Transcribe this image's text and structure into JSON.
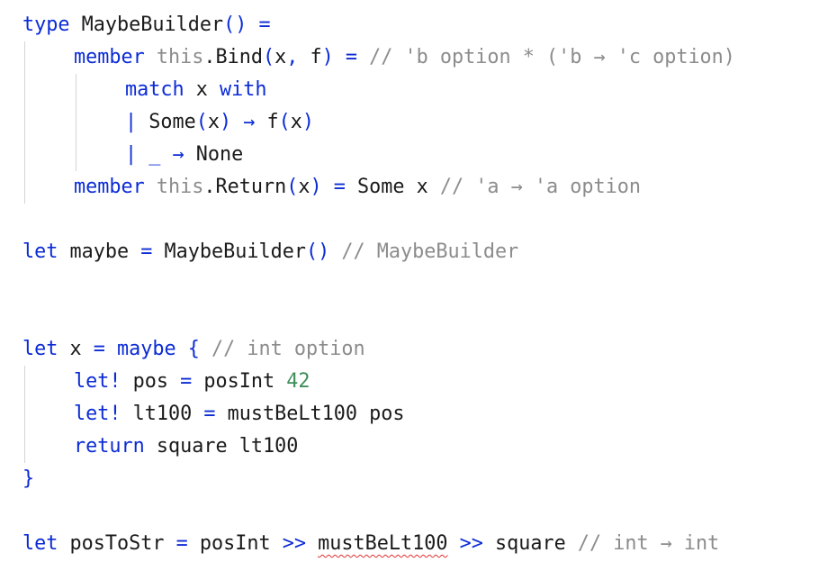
{
  "editor": {
    "colors": {
      "background": "#ffffff",
      "keyword": "#0b2bd6",
      "comment": "#8c8c8c",
      "number": "#3f8f5a",
      "text": "#1a1a1a",
      "error_underline": "#e03131"
    },
    "lines": [
      {
        "id": "L1",
        "tokens": [
          {
            "t": "type",
            "c": "kw"
          },
          {
            "t": " MaybeBuilder",
            "c": ""
          },
          {
            "t": "()",
            "c": "pn"
          },
          {
            "t": " ",
            "c": ""
          },
          {
            "t": "=",
            "c": "pn"
          }
        ]
      },
      {
        "id": "L2",
        "tokens": [
          {
            "t": "member",
            "c": "kw"
          },
          {
            "t": " ",
            "c": ""
          },
          {
            "t": "this",
            "c": "sl"
          },
          {
            "t": ".Bind",
            "c": ""
          },
          {
            "t": "(",
            "c": "pn"
          },
          {
            "t": "x",
            "c": ""
          },
          {
            "t": ",",
            "c": "pn"
          },
          {
            "t": " f",
            "c": ""
          },
          {
            "t": ")",
            "c": "pn"
          },
          {
            "t": " ",
            "c": ""
          },
          {
            "t": "=",
            "c": "pn"
          },
          {
            "t": " // 'b option * ('b → 'c option)",
            "c": "cm"
          }
        ]
      },
      {
        "id": "L3",
        "tokens": [
          {
            "t": "match",
            "c": "kw"
          },
          {
            "t": " x ",
            "c": ""
          },
          {
            "t": "with",
            "c": "kw"
          }
        ]
      },
      {
        "id": "L4",
        "tokens": [
          {
            "t": "|",
            "c": "pn"
          },
          {
            "t": " Some",
            "c": ""
          },
          {
            "t": "(",
            "c": "pn"
          },
          {
            "t": "x",
            "c": ""
          },
          {
            "t": ")",
            "c": "pn"
          },
          {
            "t": " ",
            "c": ""
          },
          {
            "t": "→",
            "c": "pn"
          },
          {
            "t": " f",
            "c": ""
          },
          {
            "t": "(",
            "c": "pn"
          },
          {
            "t": "x",
            "c": ""
          },
          {
            "t": ")",
            "c": "pn"
          }
        ]
      },
      {
        "id": "L5",
        "tokens": [
          {
            "t": "|",
            "c": "pn"
          },
          {
            "t": " ",
            "c": ""
          },
          {
            "t": "_",
            "c": "pn"
          },
          {
            "t": " ",
            "c": ""
          },
          {
            "t": "→",
            "c": "pn"
          },
          {
            "t": " None",
            "c": ""
          }
        ]
      },
      {
        "id": "L6",
        "tokens": [
          {
            "t": "member",
            "c": "kw"
          },
          {
            "t": " ",
            "c": ""
          },
          {
            "t": "this",
            "c": "sl"
          },
          {
            "t": ".Return",
            "c": ""
          },
          {
            "t": "(",
            "c": "pn"
          },
          {
            "t": "x",
            "c": ""
          },
          {
            "t": ")",
            "c": "pn"
          },
          {
            "t": " ",
            "c": ""
          },
          {
            "t": "=",
            "c": "pn"
          },
          {
            "t": " Some x",
            "c": ""
          },
          {
            "t": " // 'a → 'a option",
            "c": "cm"
          }
        ]
      },
      {
        "id": "L7",
        "tokens": [
          {
            "t": "let",
            "c": "kw"
          },
          {
            "t": " maybe ",
            "c": ""
          },
          {
            "t": "=",
            "c": "pn"
          },
          {
            "t": " MaybeBuilder",
            "c": ""
          },
          {
            "t": "()",
            "c": "pn"
          },
          {
            "t": " // MaybeBuilder",
            "c": "cm"
          }
        ]
      },
      {
        "id": "L8",
        "tokens": [
          {
            "t": "let",
            "c": "kw"
          },
          {
            "t": " x ",
            "c": ""
          },
          {
            "t": "=",
            "c": "pn"
          },
          {
            "t": " ",
            "c": ""
          },
          {
            "t": "maybe",
            "c": "kw"
          },
          {
            "t": " ",
            "c": ""
          },
          {
            "t": "{",
            "c": "pn"
          },
          {
            "t": " // int option",
            "c": "cm"
          }
        ]
      },
      {
        "id": "L9",
        "tokens": [
          {
            "t": "let!",
            "c": "kw"
          },
          {
            "t": " pos ",
            "c": ""
          },
          {
            "t": "=",
            "c": "pn"
          },
          {
            "t": " posInt ",
            "c": ""
          },
          {
            "t": "42",
            "c": "nm"
          }
        ]
      },
      {
        "id": "L10",
        "tokens": [
          {
            "t": "let!",
            "c": "kw"
          },
          {
            "t": " lt100 ",
            "c": ""
          },
          {
            "t": "=",
            "c": "pn"
          },
          {
            "t": " mustBeLt100 pos",
            "c": ""
          }
        ]
      },
      {
        "id": "L11",
        "tokens": [
          {
            "t": "return",
            "c": "kw"
          },
          {
            "t": " square lt100",
            "c": ""
          }
        ]
      },
      {
        "id": "L12",
        "tokens": [
          {
            "t": "}",
            "c": "pn"
          }
        ]
      },
      {
        "id": "L13",
        "tokens": [
          {
            "t": "let",
            "c": "kw"
          },
          {
            "t": " posToStr ",
            "c": ""
          },
          {
            "t": "=",
            "c": "pn"
          },
          {
            "t": " posInt ",
            "c": ""
          },
          {
            "t": ">>",
            "c": "pn"
          },
          {
            "t": " ",
            "c": ""
          },
          {
            "t": "mustBeLt100",
            "c": "squiggle"
          },
          {
            "t": " ",
            "c": ""
          },
          {
            "t": ">>",
            "c": "pn"
          },
          {
            "t": " square",
            "c": ""
          },
          {
            "t": " // int → int",
            "c": "cm"
          }
        ]
      }
    ]
  }
}
